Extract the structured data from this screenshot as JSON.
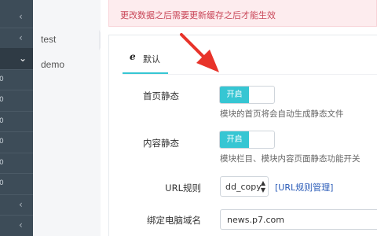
{
  "sidebar": {
    "rows": [
      {
        "chevron": "‹",
        "num": ""
      },
      {
        "chevron": "‹",
        "num": ""
      },
      {
        "chevron": "›",
        "num": "",
        "active": true
      },
      {
        "chevron": "",
        "num": "0"
      },
      {
        "chevron": "",
        "num": "0"
      },
      {
        "chevron": "",
        "num": "0"
      },
      {
        "chevron": "",
        "num": "0"
      },
      {
        "chevron": "",
        "num": "0"
      },
      {
        "chevron": "",
        "num": "0"
      },
      {
        "chevron": "‹",
        "num": ""
      },
      {
        "chevron": "‹",
        "num": ""
      }
    ]
  },
  "subnav": {
    "items": [
      "test",
      "demo"
    ]
  },
  "alert": {
    "text": "更改数据之后需要更新缓存之后才能生效"
  },
  "tab": {
    "icon": "e",
    "label": "默认"
  },
  "form": {
    "homepage_static": {
      "label": "首页静态",
      "toggle_on": "开启",
      "help": "模块的首页将会自动生成静态文件"
    },
    "content_static": {
      "label": "内容静态",
      "toggle_on": "开启",
      "help": "模块栏目、模块内容页面静态功能开关"
    },
    "url_rule": {
      "label": "URL规则",
      "selected": "dd_copy",
      "link": "[URL规则管理]"
    },
    "pc_domain": {
      "label": "绑定电脑域名",
      "value": "news.p7.com"
    }
  },
  "colors": {
    "accent": "#36c6d3",
    "alert_text": "#c94759",
    "sidebar": "#3d4c58",
    "pointer": "#e8332a"
  }
}
